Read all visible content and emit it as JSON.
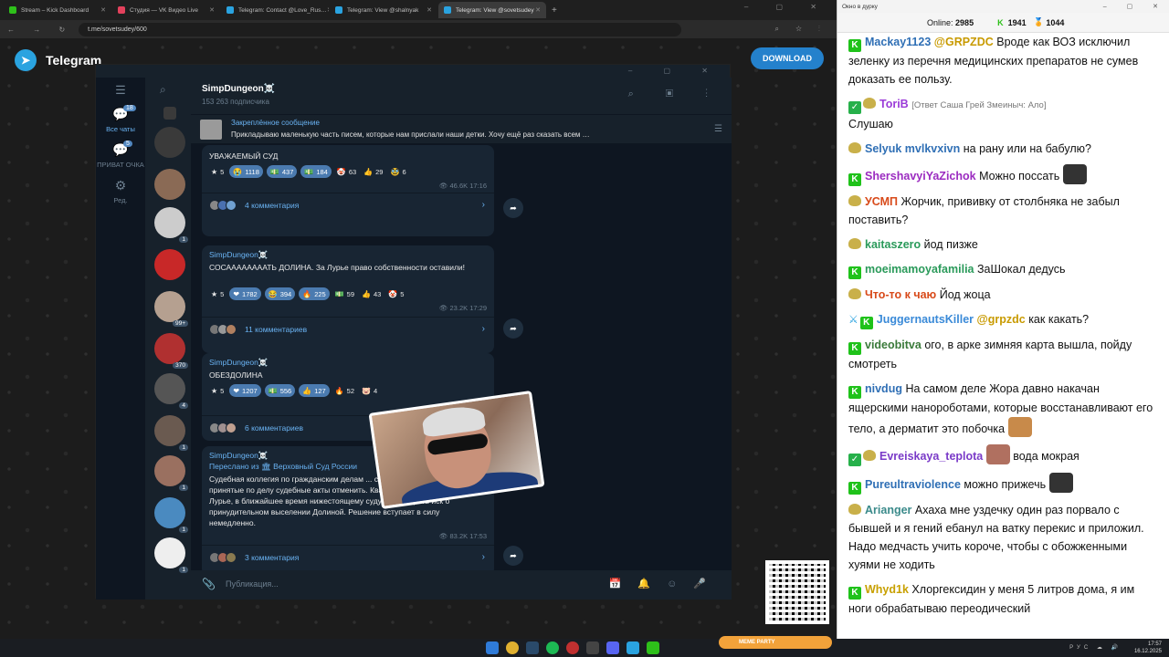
{
  "browser": {
    "tabs": [
      {
        "label": "Stream – Kick Dashboard",
        "color": "#2ec01a"
      },
      {
        "label": "Студия — VK Видео Live",
        "color": "#e3415c"
      },
      {
        "label": "Telegram: Contact @Love_Rus…",
        "color": "#2aa3e0"
      },
      {
        "label": "Telegram: View @shalnyak",
        "color": "#2aa3e0"
      },
      {
        "label": "Telegram: View @sovetsudey",
        "color": "#2aa3e0"
      }
    ],
    "url": "t.me/sovetsudey/600"
  },
  "tg_web": {
    "logo_text": "Telegram",
    "download_label": "DOWNLOAD"
  },
  "tg_app": {
    "folders": [
      {
        "label": "Все чаты",
        "badge": "18"
      },
      {
        "label": "ПРИВАТ ОЧКА",
        "badge": "5"
      },
      {
        "label": "Ред.",
        "badge": ""
      }
    ],
    "avatars": [
      {
        "color": "#3a3a3a",
        "count": ""
      },
      {
        "color": "#8a6a55",
        "count": ""
      },
      {
        "color": "#cccccc",
        "count": "1"
      },
      {
        "color": "#c82828",
        "count": ""
      },
      {
        "color": "#b5a090",
        "count": "99+"
      },
      {
        "color": "#b03030",
        "count": "370"
      },
      {
        "color": "#555555",
        "count": "4"
      },
      {
        "color": "#6a5a50",
        "count": "1"
      },
      {
        "color": "#9a7060",
        "count": "1"
      },
      {
        "color": "#4a8ac0",
        "count": "1"
      },
      {
        "color": "#eeeeee",
        "count": "1"
      }
    ],
    "channel_title": "SimpDungeon☠️",
    "channel_sub": "153 263 подписчика",
    "pinned_title": "Закреплённое сообщение",
    "pinned_text": "Прикладываю маленькую часть писем, которые нам прислали наши детки.   Хочу ещё раз сказать всем …",
    "compose_placeholder": "Публикация...",
    "messages": [
      {
        "author": "",
        "text": "УВАЖАЕМЫЙ СУД",
        "reactions": [
          {
            "e": "★",
            "n": "5",
            "hl": false
          },
          {
            "e": "😭",
            "n": "1118",
            "hl": true
          },
          {
            "e": "💵",
            "n": "437",
            "hl": true
          },
          {
            "e": "💵",
            "n": "184",
            "hl": true
          },
          {
            "e": "🤡",
            "n": "63",
            "hl": false
          },
          {
            "e": "👍",
            "n": "29",
            "hl": false
          },
          {
            "e": "🥸",
            "n": "6",
            "hl": false
          }
        ],
        "views": "46.6K",
        "time": "17:16",
        "comments": "4 комментария"
      },
      {
        "author": "SimpDungeon☠️",
        "text": "СОСААААААААТЬ ДОЛИНА. За Лурье право собственности оставили!",
        "reactions": [
          {
            "e": "★",
            "n": "5",
            "hl": false
          },
          {
            "e": "❤",
            "n": "1782",
            "hl": true
          },
          {
            "e": "😂",
            "n": "394",
            "hl": true
          },
          {
            "e": "🔥",
            "n": "225",
            "hl": true
          },
          {
            "e": "💵",
            "n": "59",
            "hl": false
          },
          {
            "e": "👍",
            "n": "43",
            "hl": false
          },
          {
            "e": "🤡",
            "n": "5",
            "hl": false
          }
        ],
        "views": "23.2K",
        "time": "17:29",
        "comments": "11 комментариев"
      },
      {
        "author": "SimpDungeon☠️",
        "text": "ОБЕЗДОЛИНА",
        "reactions": [
          {
            "e": "★",
            "n": "5",
            "hl": false
          },
          {
            "e": "❤",
            "n": "1207",
            "hl": true
          },
          {
            "e": "💵",
            "n": "556",
            "hl": true
          },
          {
            "e": "👍",
            "n": "127",
            "hl": true
          },
          {
            "e": "🔥",
            "n": "52",
            "hl": false
          },
          {
            "e": "🐷",
            "n": "4",
            "hl": false
          }
        ],
        "views": "",
        "time": "",
        "comments": "6 комментариев"
      },
      {
        "author": "SimpDungeon☠️",
        "forward": "Переслано из 🏛 Верховный Суд России",
        "text": "Судебная коллегия по гражданским делам ... суда РФ определила: ранее принятые по делу судебные акты отменить. Квартиру оставить Полине Лурье, в ближайшее время нижестоящему суду рассмотреть иск о принудительном выселении Долиной. Решение вступает в силу немедленно.",
        "views": "83.2K",
        "time": "17:53",
        "comments": "3 комментария"
      }
    ]
  },
  "kick": {
    "window_title": "Окно в дурку",
    "online_label": "Online:",
    "online_value": "2985",
    "followers": "1941",
    "subs": "1044",
    "messages": [
      {
        "badges": "k",
        "user": "Mackay1123",
        "color": "#2f6fb5",
        "mention": "@GRPZDC",
        "text": "Вроде как ВОЗ исключил зеленку из перечня медицинских препаратов не сумев доказать ее пользу."
      },
      {
        "badges": "sm",
        "user": "ToriB",
        "color": "#9b3bd8",
        "reply": "[Ответ Саша Грей Змеиныч: Ало]",
        "text": "Слушаю"
      },
      {
        "badges": "m",
        "user": "Selyuk",
        "color": "#2f6fb5",
        "mention2": "mvlkvxivn",
        "text": "на рану или на бабулю?"
      },
      {
        "badges": "k",
        "user": "ShershavyiYaZichok",
        "color": "#9b2bc0",
        "text": "Можно поссать",
        "emote": "#333333"
      },
      {
        "badges": "m",
        "user": "УСМП",
        "color": "#d84a1a",
        "text": "Жорчик, прививку от столбняка не забыл поставить?"
      },
      {
        "badges": "m",
        "user": "kaitaszero",
        "color": "#2a9a5a",
        "text": "йод пизже"
      },
      {
        "badges": "k",
        "user": "moeimamoyafamilia",
        "color": "#2a9a5a",
        "text": "ЗаШокал дедусь"
      },
      {
        "badges": "m",
        "user": "Что-то к чаю",
        "color": "#d84a1a",
        "text": "Йод жоца"
      },
      {
        "badges": "swk",
        "user": "JuggernautsKiller",
        "color": "#3a8ad8",
        "text": "как какать?",
        "mention": "@grpzdc"
      },
      {
        "badges": "k",
        "user": "videobitva",
        "color": "#3a7a3a",
        "text": "ого, в арке зимняя карта вышла, пойду смотреть"
      },
      {
        "badges": "k",
        "user": "nivdug",
        "color": "#2f6fb5",
        "text": "На самом деле Жора давно накачан ящерскими нанороботами, которые восстанавливают его тело, а дерматит это побочка",
        "emote": "#c88a4a"
      },
      {
        "badges": "sm",
        "user": "Evreiskaya_teplota",
        "color": "#7a3ac8",
        "text": "вода мокрая",
        "emote_before": "#b07060"
      },
      {
        "badges": "k",
        "user": "Pureultraviolence",
        "color": "#2f6fb5",
        "text": "можно прижечь",
        "emote": "#333333"
      },
      {
        "badges": "m",
        "user": "Arianger",
        "color": "#3a8a8a",
        "text": "Ахаха мне уздечку один раз порвало с бывшей и я гений ебанул на ватку перекис и приложил. Надо медчасть учить короче, чтобы с обожженными хуями не ходить"
      },
      {
        "badges": "k",
        "user": "Whyd1k",
        "color": "#c8a000",
        "text": "Хлоргексидин у меня 5 литров дома, я им ноги обрабатываю переодический"
      }
    ]
  },
  "taskbar": {
    "lang": "РУС",
    "time": "17:57",
    "date": "16.12.2025",
    "meme_label": "МЕМЕ PARTY"
  }
}
